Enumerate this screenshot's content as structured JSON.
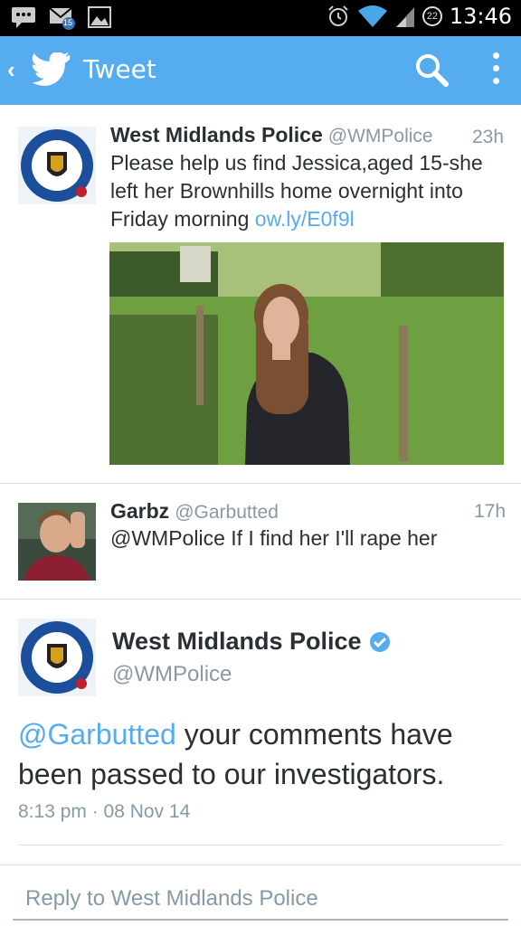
{
  "status_bar": {
    "mail_badge": "15",
    "notification_badge": "22",
    "time": "13:46",
    "icons": [
      "message-icon",
      "mail-icon",
      "image-icon",
      "alarm-icon",
      "wifi-icon",
      "signal-icon"
    ]
  },
  "app_bar": {
    "title": "Tweet",
    "back_icon": "chevron-left-icon",
    "logo_icon": "twitter-bird-icon",
    "search_icon": "search-icon",
    "menu_icon": "more-vert-icon",
    "color": "#55acee"
  },
  "tweets": [
    {
      "name": "West Midlands Police",
      "handle": "@WMPolice",
      "time": "23h",
      "text": "Please help us find Jessica,aged 15-she left her Brownhills home overnight into Friday morning ",
      "link": "ow.ly/E0f9l",
      "has_photo": true
    },
    {
      "name": "Garbz",
      "handle": "@Garbutted",
      "time": "17h",
      "text": "@WMPolice If I find her I'll rape her"
    }
  ],
  "focused_tweet": {
    "name": "West Midlands Police",
    "handle": "@WMPolice",
    "verified": true,
    "mention": "@Garbutted",
    "text": " your comments have been passed to our investigators.",
    "timestamp": "8:13 pm · 08 Nov 14"
  },
  "reply": {
    "placeholder": "Reply to West Midlands Police"
  }
}
